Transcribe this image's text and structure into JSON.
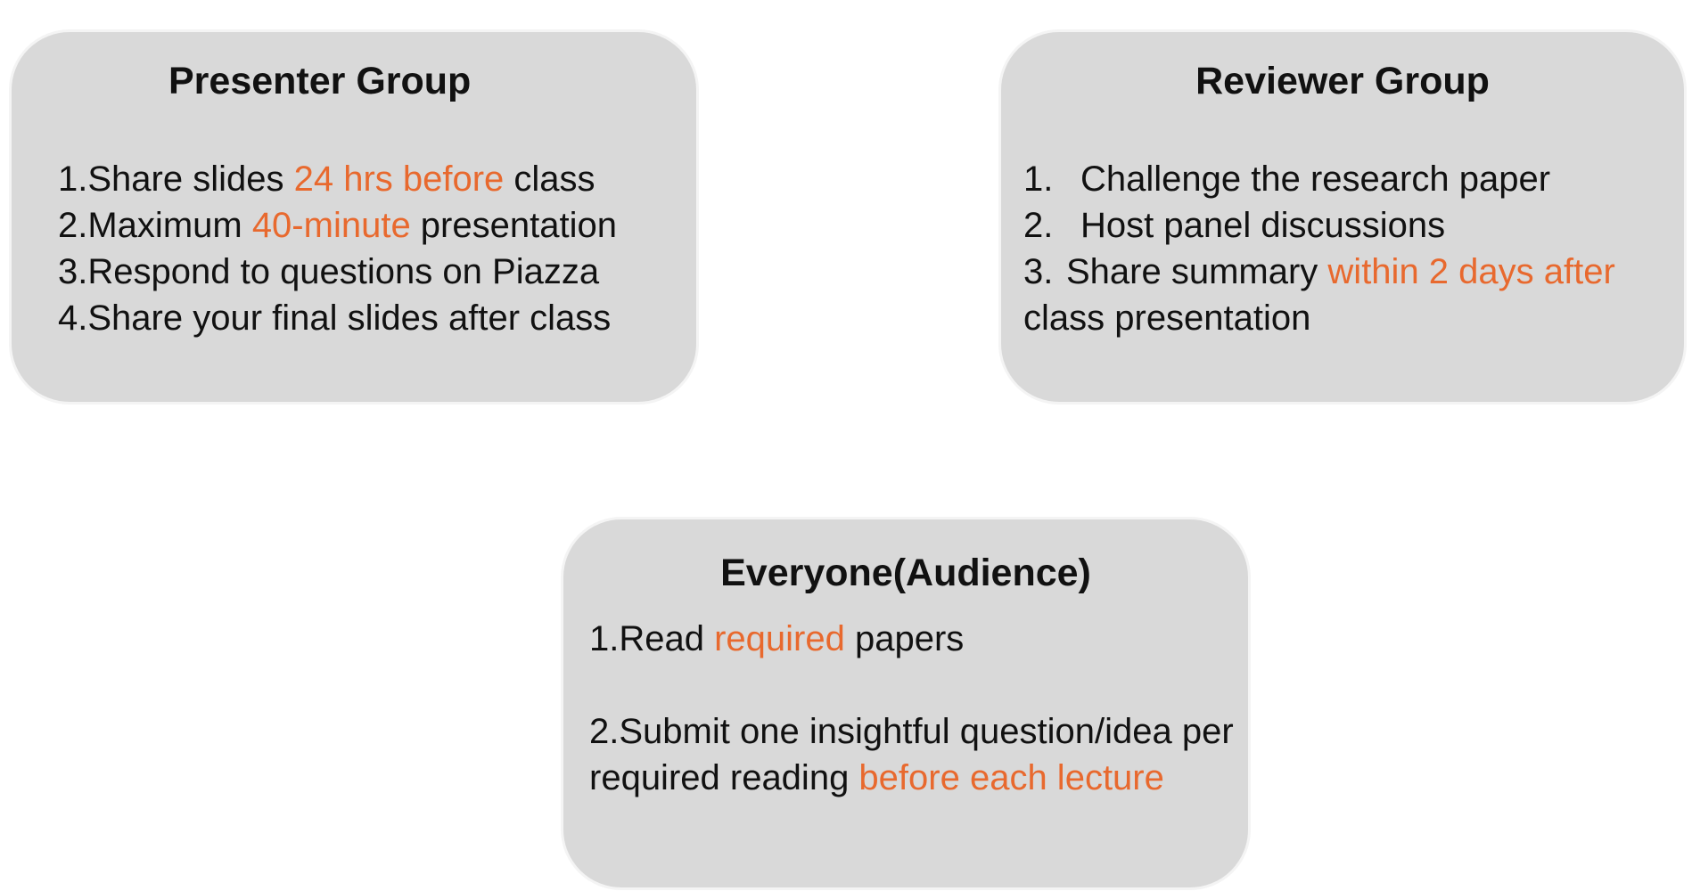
{
  "colors": {
    "box_fill": "#d9d9d9",
    "box_border": "#f4f4f4",
    "text": "#111111",
    "highlight": "#e8692e"
  },
  "presenter": {
    "title": "Presenter Group",
    "items": [
      {
        "num": "1.",
        "pre": "Share slides ",
        "hl": "24 hrs before",
        "post": " class"
      },
      {
        "num": "2.",
        "pre": "Maximum ",
        "hl": "40-minute",
        "post": " presentation"
      },
      {
        "num": "3.",
        "text": "Respond to questions on Piazza"
      },
      {
        "num": "4.",
        "text": "Share your final slides after class"
      }
    ]
  },
  "reviewer": {
    "title": "Reviewer Group",
    "items": [
      {
        "num": "1.",
        "text": "Challenge the research paper"
      },
      {
        "num": "2.",
        "text": "Host panel discussions"
      },
      {
        "num": "3.",
        "pre": "Share summary ",
        "hl": "within 2 days after",
        "post": "class presentation"
      }
    ]
  },
  "audience": {
    "title": "Everyone(Audience)",
    "items": [
      {
        "num": "1.",
        "pre": "Read ",
        "hl": "required",
        "post": " papers"
      },
      {
        "num": "2.",
        "line1": "Submit one insightful question/idea per",
        "pre": "required reading ",
        "hl": "before each lecture"
      }
    ]
  }
}
